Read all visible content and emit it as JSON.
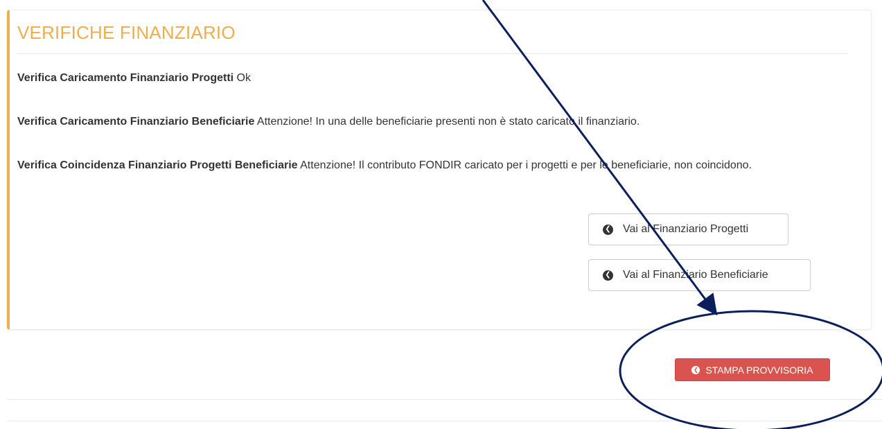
{
  "panel": {
    "title": "VERIFICHE FINANZIARIO",
    "checks": [
      {
        "label": "Verifica Caricamento Finanziario Progetti",
        "result": " Ok"
      },
      {
        "label": "Verifica Caricamento Finanziario Beneficiarie",
        "result": " Attenzione! In una delle beneficiarie presenti non è stato caricato il finanziario."
      },
      {
        "label": "Verifica Coincidenza Finanziario Progetti Beneficiarie",
        "result": " Attenzione! Il contributo FONDIR caricato per i progetti e per le beneficiarie, non coincidono."
      }
    ],
    "buttons": {
      "progetti": "Vai al Finanziario Progetti",
      "beneficiarie": "Vai al Finanziario Beneficiarie"
    }
  },
  "footer": {
    "print_button": "STAMPA PROVVISORIA"
  },
  "icons": {
    "nav_button_icon": "circle-arrow-left-icon",
    "print_button_icon": "circle-arrow-left-icon"
  },
  "colors": {
    "accent": "#f0ad4e",
    "danger": "#d9534f",
    "annotation": "#0b1f5c"
  }
}
